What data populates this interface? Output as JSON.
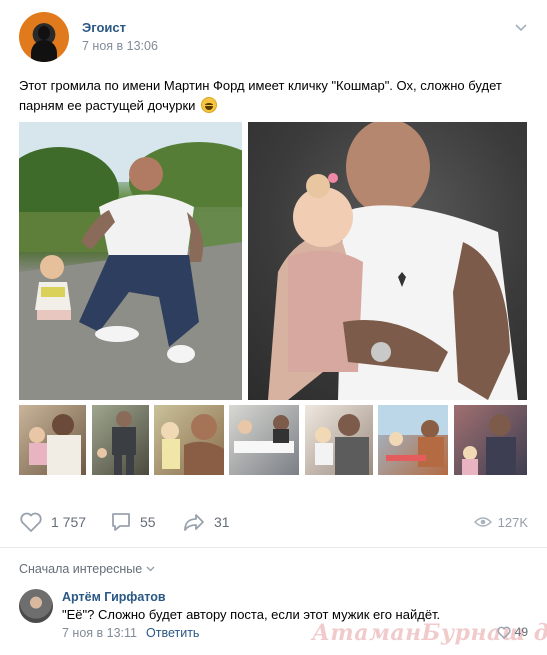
{
  "post": {
    "author": "Эгоист",
    "time": "7 ноя в 13:06",
    "text": "Этот громила по имени Мартин Форд имеет кличку \"Кошмар\". Ох, сложно будет парням ее растущей дочурки"
  },
  "actions": {
    "likes": "1 757",
    "comments": "55",
    "shares": "31",
    "views": "127K"
  },
  "comments": {
    "sort_label": "Сначала интересные",
    "items": [
      {
        "author": "Артём Гирфатов",
        "text": "\"Её\"? Сложно будет автору поста, если этот мужик его найдёт.",
        "time": "7 ноя в 13:11",
        "reply_label": "Ответить",
        "likes": "49"
      }
    ]
  },
  "watermark": "АтаманБурнаш дот ЯП",
  "icons": [
    "more-chevron-icon",
    "heart-icon",
    "comment-icon",
    "share-icon",
    "eye-icon",
    "sort-chevron-icon"
  ]
}
